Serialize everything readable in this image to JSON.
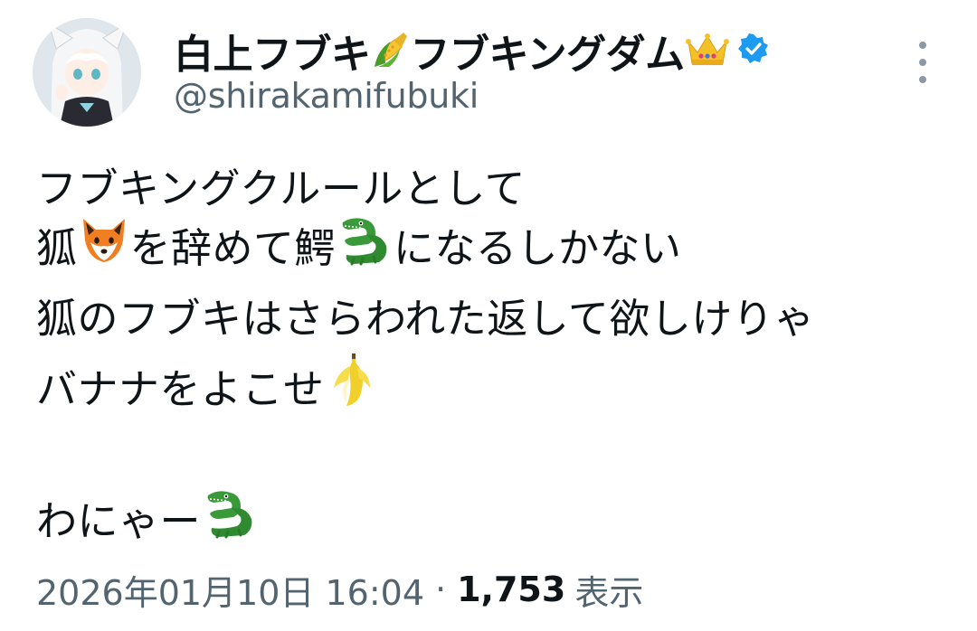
{
  "tweet": {
    "display_name_part1": "白上フブキ",
    "display_name_part2": "フブキングダム",
    "handle": "@shirakamifubuki",
    "lines": {
      "l1": "フブキングクルールとして",
      "l2a": "狐",
      "l2b": "を辞めて鰐",
      "l2c": "になるしかない",
      "l3": "狐のフブキはさらわれた返して欲しけりゃ",
      "l4": "バナナをよこせ",
      "l6": "わにゃー"
    },
    "timestamp": "2026年01月10日 16:04",
    "separator": "·",
    "views_count": "1,753",
    "views_label": "表示"
  },
  "icons": {
    "name_emoji_1": "corn-emoji",
    "name_emoji_2": "crown-emoji",
    "verified": "verified-badge-icon",
    "more": "more-vertical-icon",
    "fox": "fox-emoji",
    "crocodile": "crocodile-emoji",
    "banana": "banana-emoji"
  },
  "colors": {
    "text": "#0f1419",
    "secondary": "#536471",
    "verified_blue": "#1d9bf0"
  }
}
